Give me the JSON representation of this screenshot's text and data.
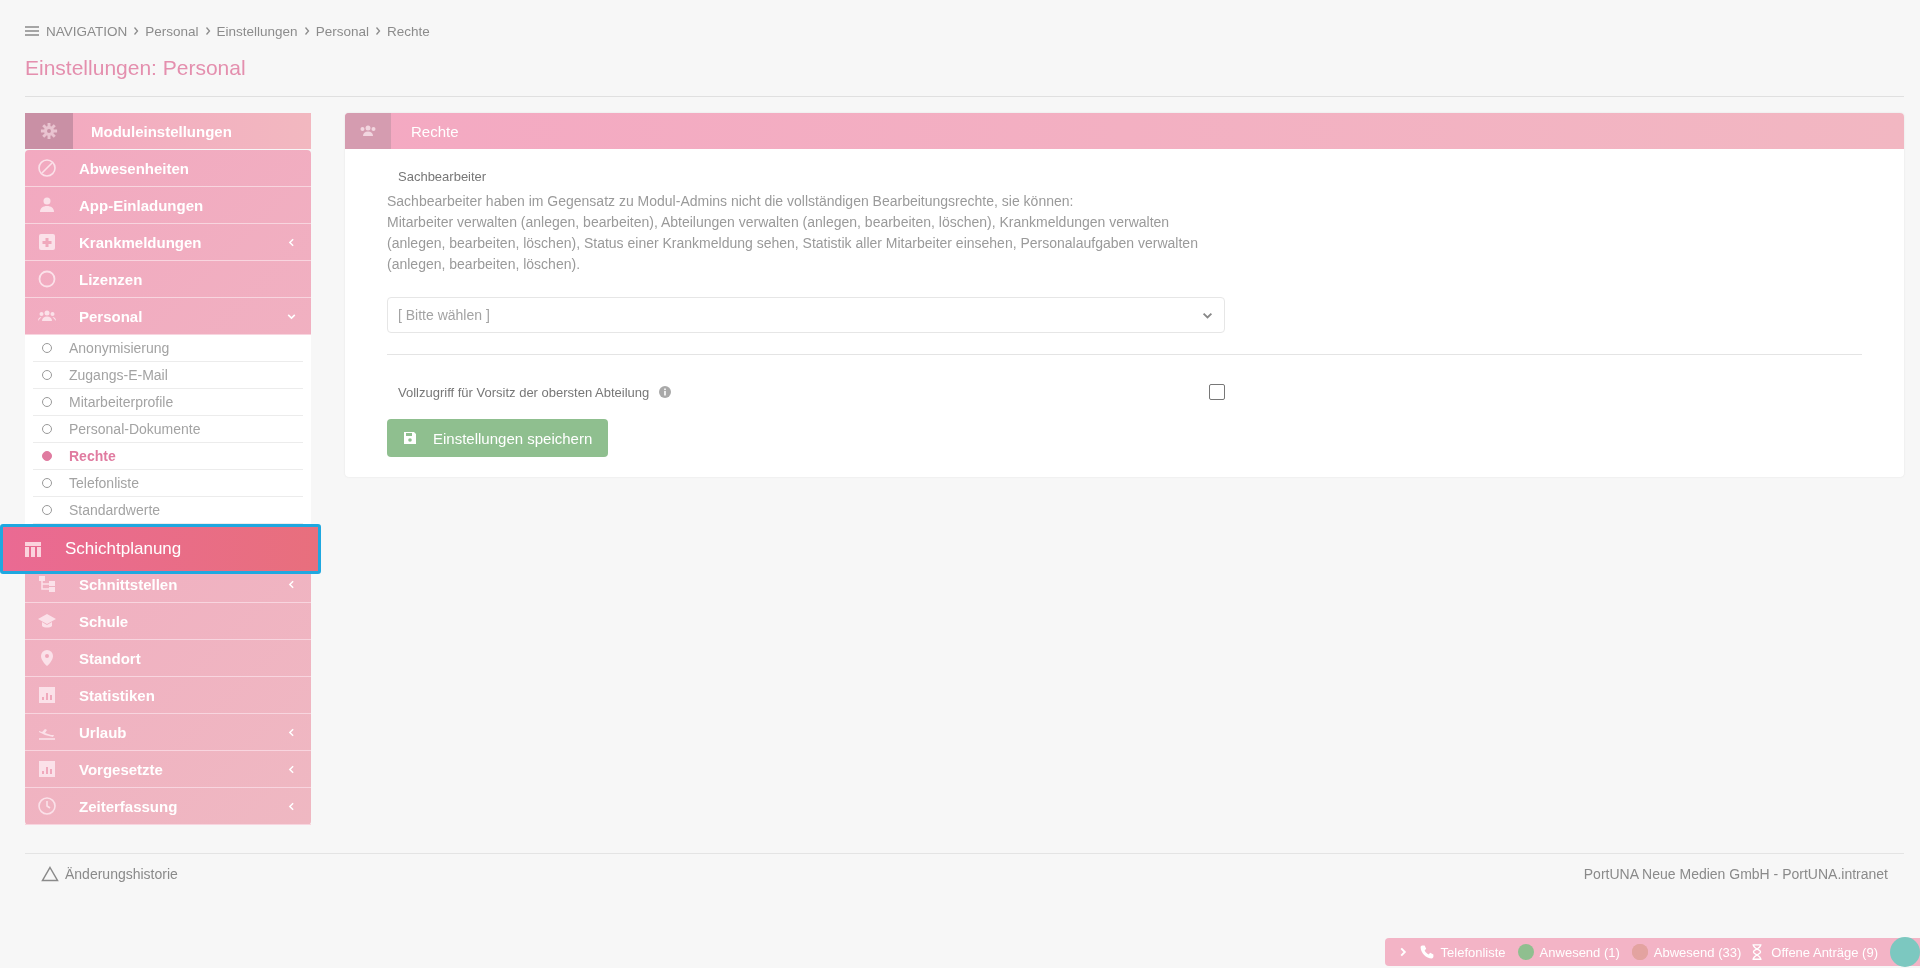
{
  "breadcrumb": {
    "menu_label": "NAVIGATION",
    "path": [
      "Personal",
      "Einstellungen",
      "Personal",
      "Rechte"
    ]
  },
  "page_title": "Einstellungen: Personal",
  "sidebar": {
    "header": "Moduleinstellungen",
    "items": [
      {
        "label": "Abwesenheiten",
        "submenu": false,
        "expanded": false,
        "highlighted": false
      },
      {
        "label": "App-Einladungen",
        "submenu": false,
        "expanded": false,
        "highlighted": false
      },
      {
        "label": "Krankmeldungen",
        "submenu": true,
        "expanded": false,
        "highlighted": false
      },
      {
        "label": "Lizenzen",
        "submenu": false,
        "expanded": false,
        "highlighted": false
      },
      {
        "label": "Personal",
        "submenu": true,
        "expanded": true,
        "highlighted": false,
        "children": [
          {
            "label": "Anonymisierung",
            "selected": false
          },
          {
            "label": "Zugangs-E-Mail",
            "selected": false
          },
          {
            "label": "Mitarbeiterprofile",
            "selected": false
          },
          {
            "label": "Personal-Dokumente",
            "selected": false
          },
          {
            "label": "Rechte",
            "selected": true
          },
          {
            "label": "Telefonliste",
            "selected": false
          },
          {
            "label": "Standardwerte",
            "selected": false
          }
        ]
      },
      {
        "label": "Schichtplanung",
        "submenu": false,
        "expanded": false,
        "highlighted": true
      },
      {
        "label": "Schnittstellen",
        "submenu": true,
        "expanded": false,
        "highlighted": false
      },
      {
        "label": "Schule",
        "submenu": false,
        "expanded": false,
        "highlighted": false
      },
      {
        "label": "Standort",
        "submenu": false,
        "expanded": false,
        "highlighted": false
      },
      {
        "label": "Statistiken",
        "submenu": false,
        "expanded": false,
        "highlighted": false
      },
      {
        "label": "Urlaub",
        "submenu": true,
        "expanded": false,
        "highlighted": false
      },
      {
        "label": "Vorgesetzte",
        "submenu": true,
        "expanded": false,
        "highlighted": false
      },
      {
        "label": "Zeiterfassung",
        "submenu": true,
        "expanded": false,
        "highlighted": false
      }
    ]
  },
  "panel": {
    "title": "Rechte",
    "section_label": "Sachbearbeiter",
    "description": "Sachbearbeiter haben im Gegensatz zu Modul-Admins nicht die vollständigen Bearbeitungsrechte, sie können:\nMitarbeiter verwalten (anlegen, bearbeiten), Abteilungen verwalten (anlegen, bearbeiten, löschen), Krankmeldungen verwalten (anlegen, bearbeiten, löschen), Status einer Krankmeldung sehen, Statistik aller Mitarbeiter einsehen, Personalaufgaben verwalten (anlegen, bearbeiten, löschen).",
    "select": {
      "placeholder": "[ Bitte wählen ]"
    },
    "checkbox": {
      "label": "Vollzugriff für Vorsitz der obersten Abteilung",
      "checked": false
    },
    "save_button": "Einstellungen speichern"
  },
  "footer": {
    "history_link": "Änderungshistorie",
    "copyright": "PortUNA Neue Medien GmbH - PortUNA.intranet"
  },
  "status_bar": {
    "items": [
      {
        "kind": "phone",
        "label": "Telefonliste"
      },
      {
        "kind": "dot",
        "label": "Anwesend (1)",
        "color": "#8fbf8f"
      },
      {
        "kind": "square-dot",
        "label": "Abwesend (33)",
        "color": "#e3a3a0"
      },
      {
        "kind": "hourglass",
        "label": "Offene Anträge (9)"
      }
    ]
  }
}
